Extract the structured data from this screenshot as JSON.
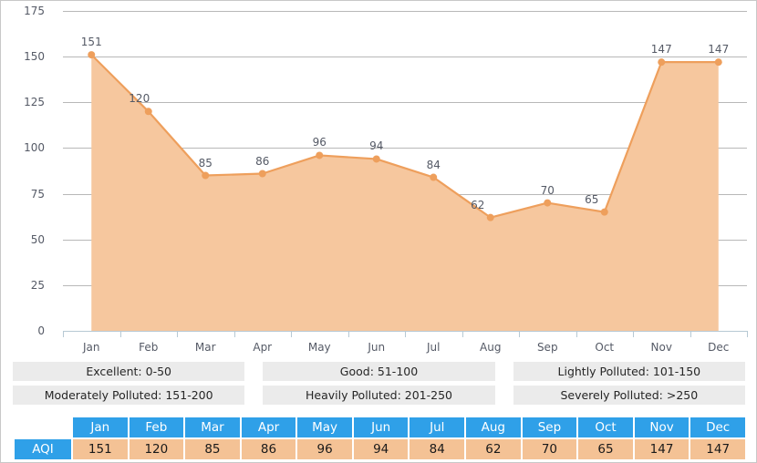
{
  "chart_data": {
    "type": "area",
    "title": "",
    "xlabel": "",
    "ylabel": "",
    "categories": [
      "Jan",
      "Feb",
      "Mar",
      "Apr",
      "May",
      "Jun",
      "Jul",
      "Aug",
      "Sep",
      "Oct",
      "Nov",
      "Dec"
    ],
    "series": [
      {
        "name": "AQI",
        "values": [
          151,
          120,
          85,
          86,
          96,
          94,
          84,
          62,
          70,
          65,
          147,
          147
        ]
      }
    ],
    "ylim": [
      0,
      175
    ],
    "yticks": [
      0,
      25,
      50,
      75,
      100,
      125,
      150,
      175
    ],
    "ytick_labels": [
      "0",
      "25",
      "50",
      "75",
      "100",
      "125",
      "150",
      "175"
    ],
    "grid": true,
    "legend_position": "below-chart",
    "point_labels": [
      "151",
      "120",
      "85",
      "86",
      "96",
      "94",
      "84",
      "62",
      "70",
      "65",
      "147",
      "147"
    ],
    "colors": {
      "area_fill": "#f6c79e",
      "line": "#ee9f5c",
      "marker": "#ee9f5c",
      "gridline": "#b8b8b8",
      "axis": "#b7c9d4",
      "tick_text": "#555a66"
    }
  },
  "legend": {
    "items": [
      "Excellent: 0-50",
      "Good: 51-100",
      "Lightly Polluted: 101-150",
      "Moderately Polluted: 151-200",
      "Heavily Polluted: 201-250",
      "Severely Polluted: >250"
    ],
    "colors": {
      "background": "#ebebeb",
      "text": "#262626"
    }
  },
  "table": {
    "row_label": "AQI",
    "columns": [
      "Jan",
      "Feb",
      "Mar",
      "Apr",
      "May",
      "Jun",
      "Jul",
      "Aug",
      "Sep",
      "Oct",
      "Nov",
      "Dec"
    ],
    "values": [
      "151",
      "120",
      "85",
      "86",
      "96",
      "94",
      "84",
      "62",
      "70",
      "65",
      "147",
      "147"
    ],
    "colors": {
      "header_background": "#2fa0e8",
      "header_text": "#ffffff",
      "cell_background": "#f4c295",
      "cell_text": "#1a1a1a"
    }
  }
}
